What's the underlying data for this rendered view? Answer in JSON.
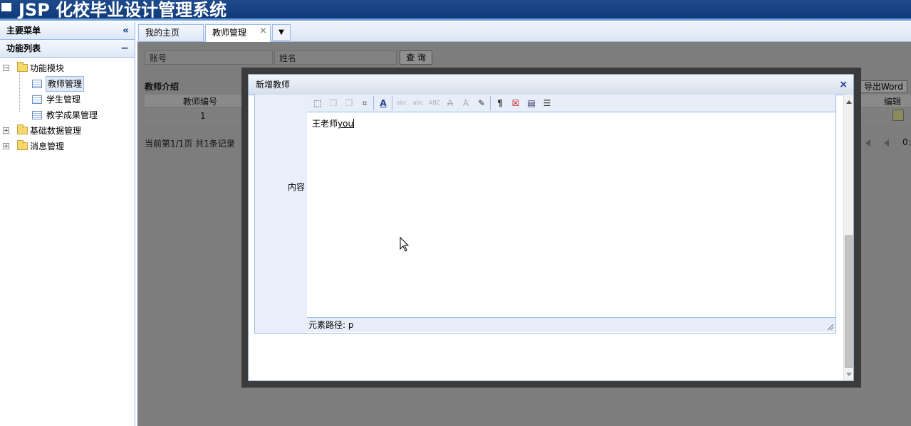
{
  "header": {
    "title": "JSP 化校毕业设计管理系统"
  },
  "sidebar": {
    "menu_title": "主要菜单",
    "collapse_glyph": "«",
    "section_title": "功能列表",
    "section_ctrl": "−",
    "tree": [
      {
        "label": "功能模块",
        "expanded": true,
        "children": [
          {
            "label": "教师管理",
            "selected": true
          },
          {
            "label": "学生管理"
          },
          {
            "label": "教学成果管理"
          }
        ]
      },
      {
        "label": "基础数据管理"
      },
      {
        "label": "消息管理"
      }
    ]
  },
  "tabs": {
    "items": [
      {
        "label": "我的主页"
      },
      {
        "label": "教师管理",
        "close": "×"
      }
    ]
  },
  "content": {
    "search": {
      "account_placeholder": "账号",
      "name_placeholder": "姓名",
      "query_label": "查 询"
    },
    "section_title": "教师介绍",
    "export_label": "导出Word",
    "grid": {
      "columns": [
        "教师编号",
        "编辑"
      ],
      "rows": [
        [
          "1"
        ]
      ]
    },
    "pager_text": "当前第1/1页 共1条记录",
    "pager_tail": "0:"
  },
  "modal": {
    "title": "新增教师",
    "close": "×",
    "field_label": "内容",
    "editor_text_plain": "王老师",
    "editor_text_underlined": "you",
    "status_text": "元素路径: p"
  }
}
